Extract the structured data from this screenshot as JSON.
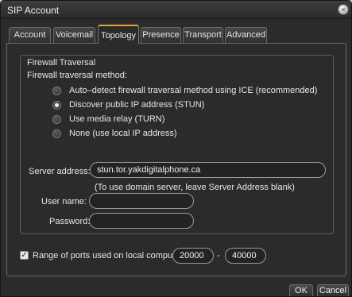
{
  "window": {
    "title": "SIP Account"
  },
  "tabs": [
    {
      "label": "Account",
      "active": false
    },
    {
      "label": "Voicemail",
      "active": false
    },
    {
      "label": "Topology",
      "active": true
    },
    {
      "label": "Presence",
      "active": false
    },
    {
      "label": "Transport",
      "active": false
    },
    {
      "label": "Advanced",
      "active": false
    }
  ],
  "firewall": {
    "group_title": "Firewall Traversal",
    "method_label": "Firewall traversal method:",
    "options": [
      {
        "label": "Auto–detect firewall traversal method using ICE (recommended)",
        "checked": false
      },
      {
        "label": "Discover public IP address (STUN)",
        "checked": true
      },
      {
        "label": "Use media relay (TURN)",
        "checked": false
      },
      {
        "label": "None (use local IP address)",
        "checked": false
      }
    ],
    "server_address_label": "Server address:",
    "server_address_value": "stun.tor.yakdigitalphone.ca",
    "server_hint": "(To use domain server, leave Server Address blank)",
    "username_label": "User name:",
    "username_value": "",
    "password_label": "Password:",
    "password_value": ""
  },
  "ports": {
    "checked": true,
    "label": "Range of ports used on local computer:",
    "from": "20000",
    "separator": "-",
    "to": "40000"
  },
  "footer": {
    "ok_label": "OK",
    "cancel_label": "Cancel"
  }
}
